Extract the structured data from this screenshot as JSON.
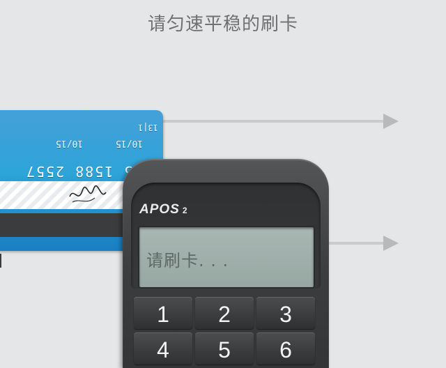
{
  "instruction": "请匀速平稳的刷卡",
  "card": {
    "code": "13|1",
    "date1": "10/15",
    "date2": "10/15",
    "number": "1285 1588 2557"
  },
  "device": {
    "brand": "APOS",
    "brand_sub": "2",
    "screen_text": "请刷卡. . .",
    "keys": [
      "1",
      "2",
      "3",
      "4",
      "5",
      "6"
    ]
  },
  "colors": {
    "background": "#e4e6e7",
    "card_blue": "#1c8ccf",
    "device_body": "#3b3d3e",
    "screen": "#a9b7b3"
  }
}
